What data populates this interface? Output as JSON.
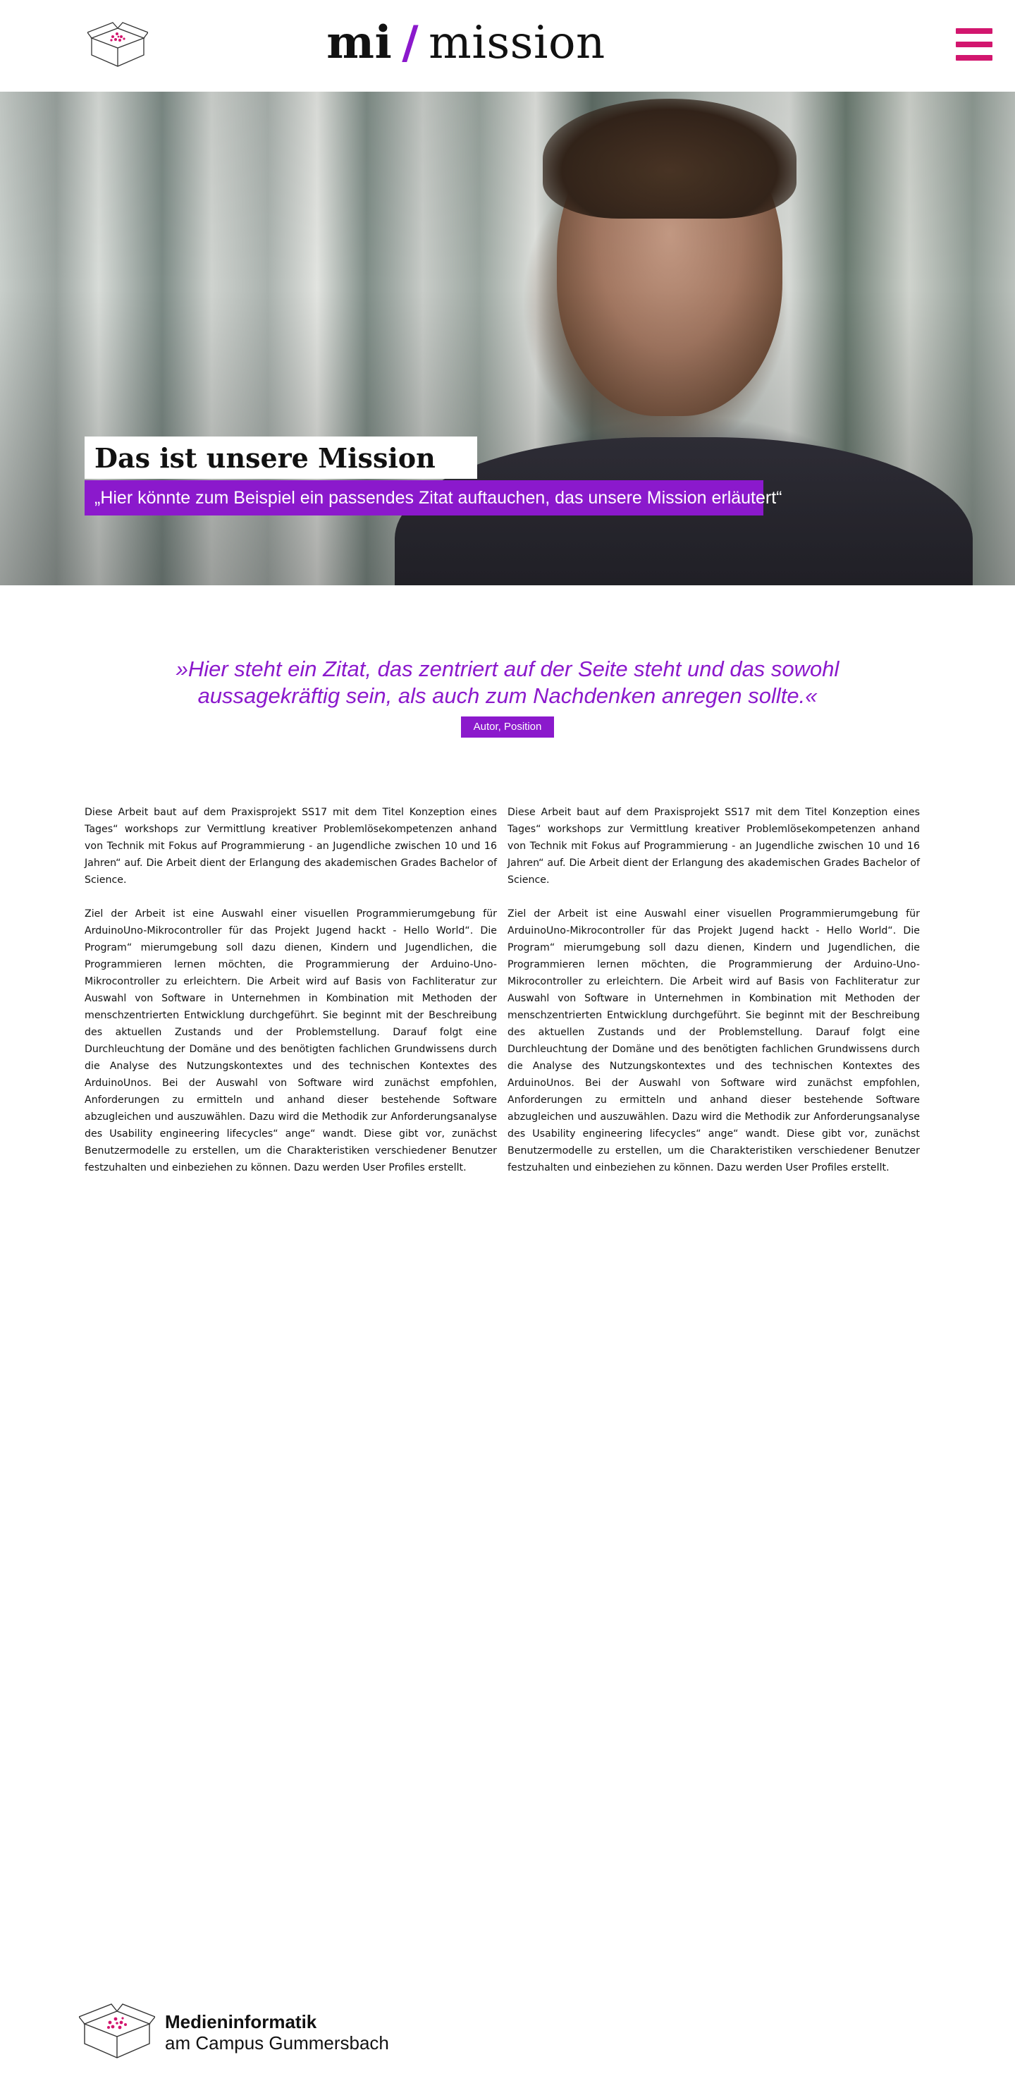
{
  "header": {
    "title_part1": "mi",
    "title_slash": "/",
    "title_part2": "mission",
    "menu_icon": "hamburger-icon",
    "logo_icon": "box-logo-icon"
  },
  "hero": {
    "title": "Das ist unsere Mission",
    "quote": "„Hier könnte zum Beispiel ein passendes Zitat auftauchen, das unsere Mission erläutert“"
  },
  "pull_quote": {
    "text": "»Hier steht ein Zitat, das zentriert auf der Seite steht und das sowohl aussagekräftig sein, als auch zum Nachdenken anregen sollte.«",
    "author": "Autor, Position"
  },
  "content": {
    "left": {
      "p1": "Diese Arbeit baut auf dem Praxisprojekt SS17 mit dem Titel Konzeption eines Tages“ workshops zur Vermittlung kreativer Problemlösekompetenzen anhand von Technik mit Fokus auf Programmierung - an Jugendliche zwischen 10 und 16 Jahren“ auf. Die Arbeit dient der Erlangung des akademischen Grades Bachelor of Science.",
      "p2": "Ziel der Arbeit ist eine Auswahl einer visuellen Programmierumgebung für ArduinoUno-Mikrocontroller für das Projekt Jugend hackt - Hello World“. Die Program“ mierumgebung soll dazu dienen, Kindern und Jugendlichen, die Programmieren lernen möchten, die Programmierung der Arduino-Uno-Mikrocontroller zu erleichtern. Die Arbeit wird auf Basis von Fachliteratur zur Auswahl von Software in Unternehmen in Kombination mit Methoden der menschzentrierten Entwicklung durchgeführt. Sie beginnt mit der Beschreibung des aktuellen Zustands und der Problemstellung. Darauf folgt eine Durchleuchtung der Domäne und des benötigten fachlichen Grundwissens durch die Analyse des Nutzungskontextes und des technischen Kontextes des ArduinoUnos. Bei der Auswahl von Software wird zunächst empfohlen, Anforderungen zu ermitteln und anhand dieser bestehende Software abzugleichen und auszuwählen. Dazu wird die Methodik zur Anforderungsanalyse des Usability engineering lifecycles“ ange“ wandt. Diese gibt vor, zunächst Benutzermodelle zu erstellen, um die Charakteristiken verschiedener Benutzer festzuhalten und einbeziehen zu können. Dazu werden User Profiles erstellt."
    },
    "right": {
      "p1": "Diese Arbeit baut auf dem Praxisprojekt SS17 mit dem Titel Konzeption eines Tages“ workshops zur Vermittlung kreativer Problemlösekompetenzen anhand von Technik mit Fokus auf Programmierung - an Jugendliche zwischen 10 und 16 Jahren“ auf. Die Arbeit dient der Erlangung des akademischen Grades Bachelor of Science.",
      "p2": "Ziel der Arbeit ist eine Auswahl einer visuellen Programmierumgebung für ArduinoUno-Mikrocontroller für das Projekt Jugend hackt - Hello World“. Die Program“ mierumgebung soll dazu dienen, Kindern und Jugendlichen, die Programmieren lernen möchten, die Programmierung der Arduino-Uno-Mikrocontroller zu erleichtern. Die Arbeit wird auf Basis von Fachliteratur zur Auswahl von Software in Unternehmen in Kombination mit Methoden der menschzentrierten Entwicklung durchgeführt. Sie beginnt mit der Beschreibung des aktuellen Zustands und der Problemstellung. Darauf folgt eine Durchleuchtung der Domäne und des benötigten fachlichen Grundwissens durch die Analyse des Nutzungskontextes und des technischen Kontextes des ArduinoUnos. Bei der Auswahl von Software wird zunächst empfohlen, Anforderungen zu ermitteln und anhand dieser bestehende Software abzugleichen und auszuwählen. Dazu wird die Methodik zur Anforderungsanalyse des Usability engineering lifecycles“ ange“ wandt. Diese gibt vor, zunächst Benutzermodelle zu erstellen, um die Charakteristiken verschiedener Benutzer festzuhalten und einbeziehen zu können. Dazu werden User Profiles erstellt."
    }
  },
  "footer": {
    "line1": "Medieninformatik",
    "line2": "am Campus Gummersbach",
    "logo_icon": "box-logo-icon"
  },
  "colors": {
    "accent_purple": "#8b19cc",
    "menu_magenta": "#d2166e"
  }
}
